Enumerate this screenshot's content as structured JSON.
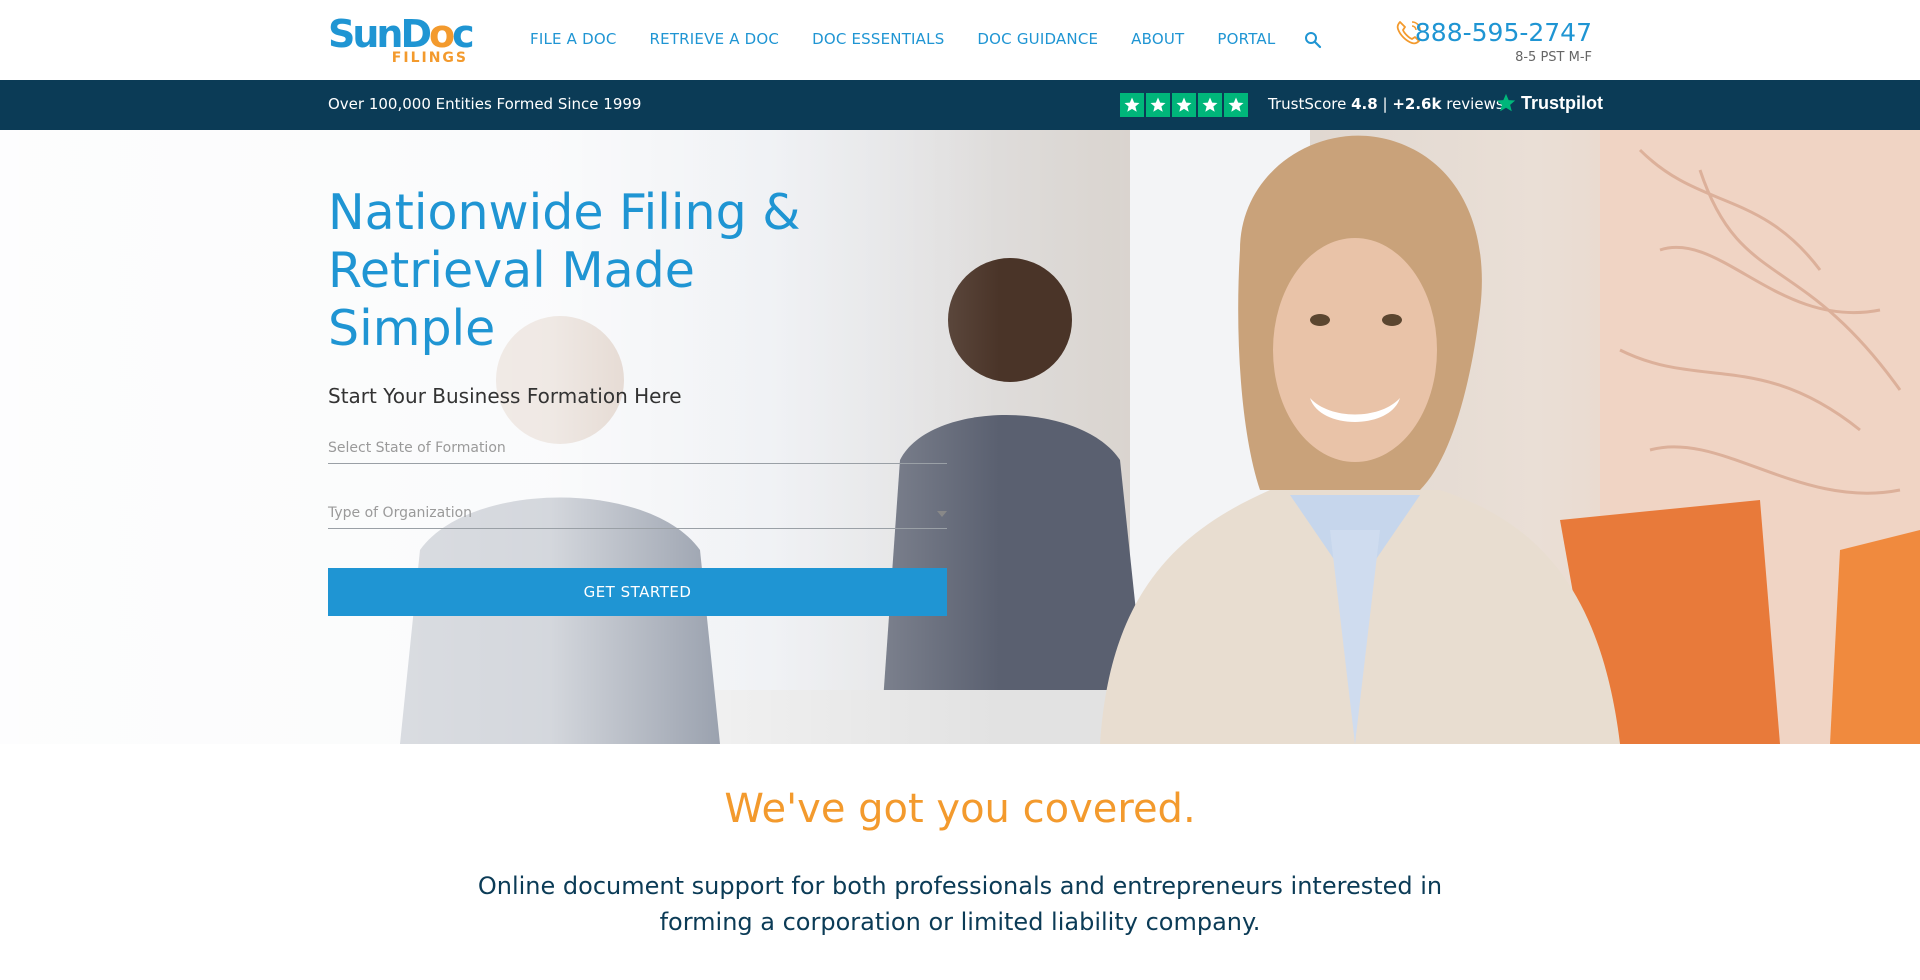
{
  "header": {
    "logo": {
      "brand_prefix": "SunD",
      "brand_o": "o",
      "brand_suffix": "c",
      "sub": "FILINGS"
    },
    "nav": [
      "FILE A DOC",
      "RETRIEVE A DOC",
      "DOC ESSENTIALS",
      "DOC GUIDANCE",
      "ABOUT",
      "PORTAL"
    ],
    "phone": {
      "number": "888-595-2747",
      "hours": "8-5 PST M-F"
    }
  },
  "trustbar": {
    "claim": "Over 100,000 Entities Formed Since 1999",
    "stars": 5,
    "trustscore_label": "TrustScore",
    "trustscore_value": "4.8",
    "separator": "|",
    "reviews_count": "+2.6k",
    "reviews_label": "reviews",
    "provider": "Trustpilot"
  },
  "hero": {
    "title": "Nationwide Filing & Retrieval Made Simple",
    "subtitle": "Start Your Business Formation Here",
    "state_placeholder": "Select State of Formation",
    "type_placeholder": "Type of Organization",
    "cta": "GET STARTED"
  },
  "covered": {
    "heading": "We've got you covered.",
    "body": "Online document support for both professionals and entrepreneurs interested in forming a corporation or limited liability company."
  },
  "colors": {
    "primary": "#1f95d3",
    "accent": "#f39a2d",
    "navy": "#0b3b56",
    "trustpilot_green": "#00b67a"
  }
}
